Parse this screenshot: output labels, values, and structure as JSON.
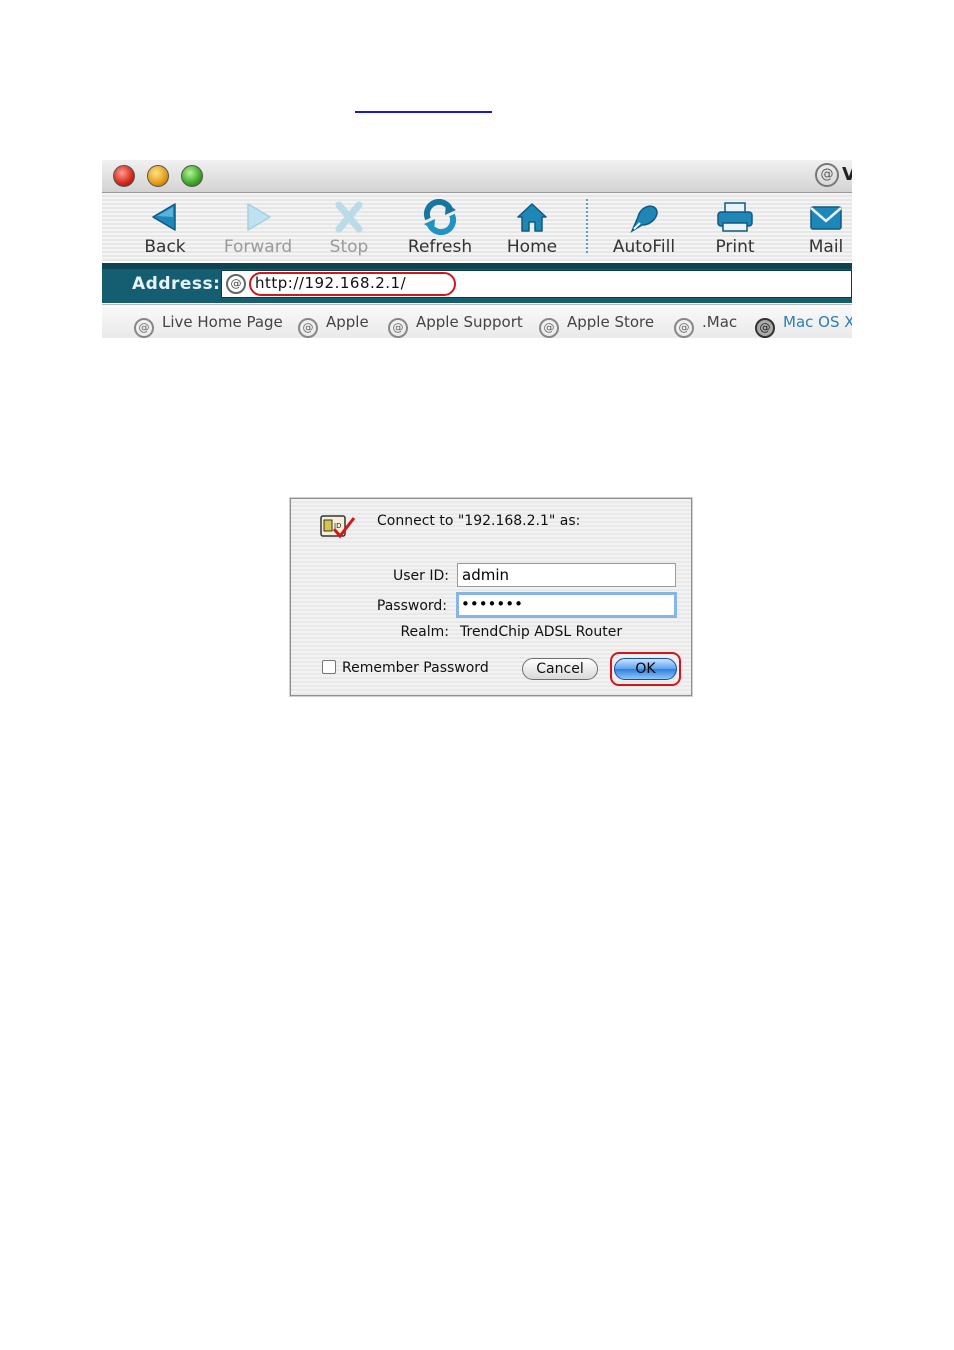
{
  "browser": {
    "title_fragment": "V",
    "toolbar": [
      {
        "name": "back",
        "label": "Back",
        "icon": "back-arrow-icon",
        "enabled": true
      },
      {
        "name": "forward",
        "label": "Forward",
        "icon": "forward-arrow-icon",
        "enabled": false
      },
      {
        "name": "stop",
        "label": "Stop",
        "icon": "stop-x-icon",
        "enabled": false
      },
      {
        "name": "refresh",
        "label": "Refresh",
        "icon": "refresh-icon",
        "enabled": true
      },
      {
        "name": "home",
        "label": "Home",
        "icon": "home-icon",
        "enabled": true
      },
      {
        "name": "autofill",
        "label": "AutoFill",
        "icon": "autofill-icon",
        "enabled": true
      },
      {
        "name": "print",
        "label": "Print",
        "icon": "printer-icon",
        "enabled": true
      },
      {
        "name": "mail",
        "label": "Mail",
        "icon": "mail-icon",
        "enabled": true
      }
    ],
    "address": {
      "label": "Address:",
      "url": "http://192.168.2.1/"
    },
    "favorites": [
      {
        "label": "Live Home Page"
      },
      {
        "label": "Apple"
      },
      {
        "label": "Apple Support"
      },
      {
        "label": "Apple Store"
      },
      {
        "label": ".Mac"
      },
      {
        "label": "Mac OS X"
      }
    ],
    "colors": {
      "address_bar": "#155e72",
      "highlight": "#d2161a"
    }
  },
  "dialog": {
    "prompt": "Connect to \"192.168.2.1\" as:",
    "user_id_label": "User ID:",
    "user_id_value": "admin",
    "password_label": "Password:",
    "password_value": "•••••••",
    "realm_label": "Realm:",
    "realm_value": "TrendChip ADSL Router",
    "remember_label": "Remember Password",
    "cancel_label": "Cancel",
    "ok_label": "OK",
    "icon": "keychain-id-icon"
  }
}
